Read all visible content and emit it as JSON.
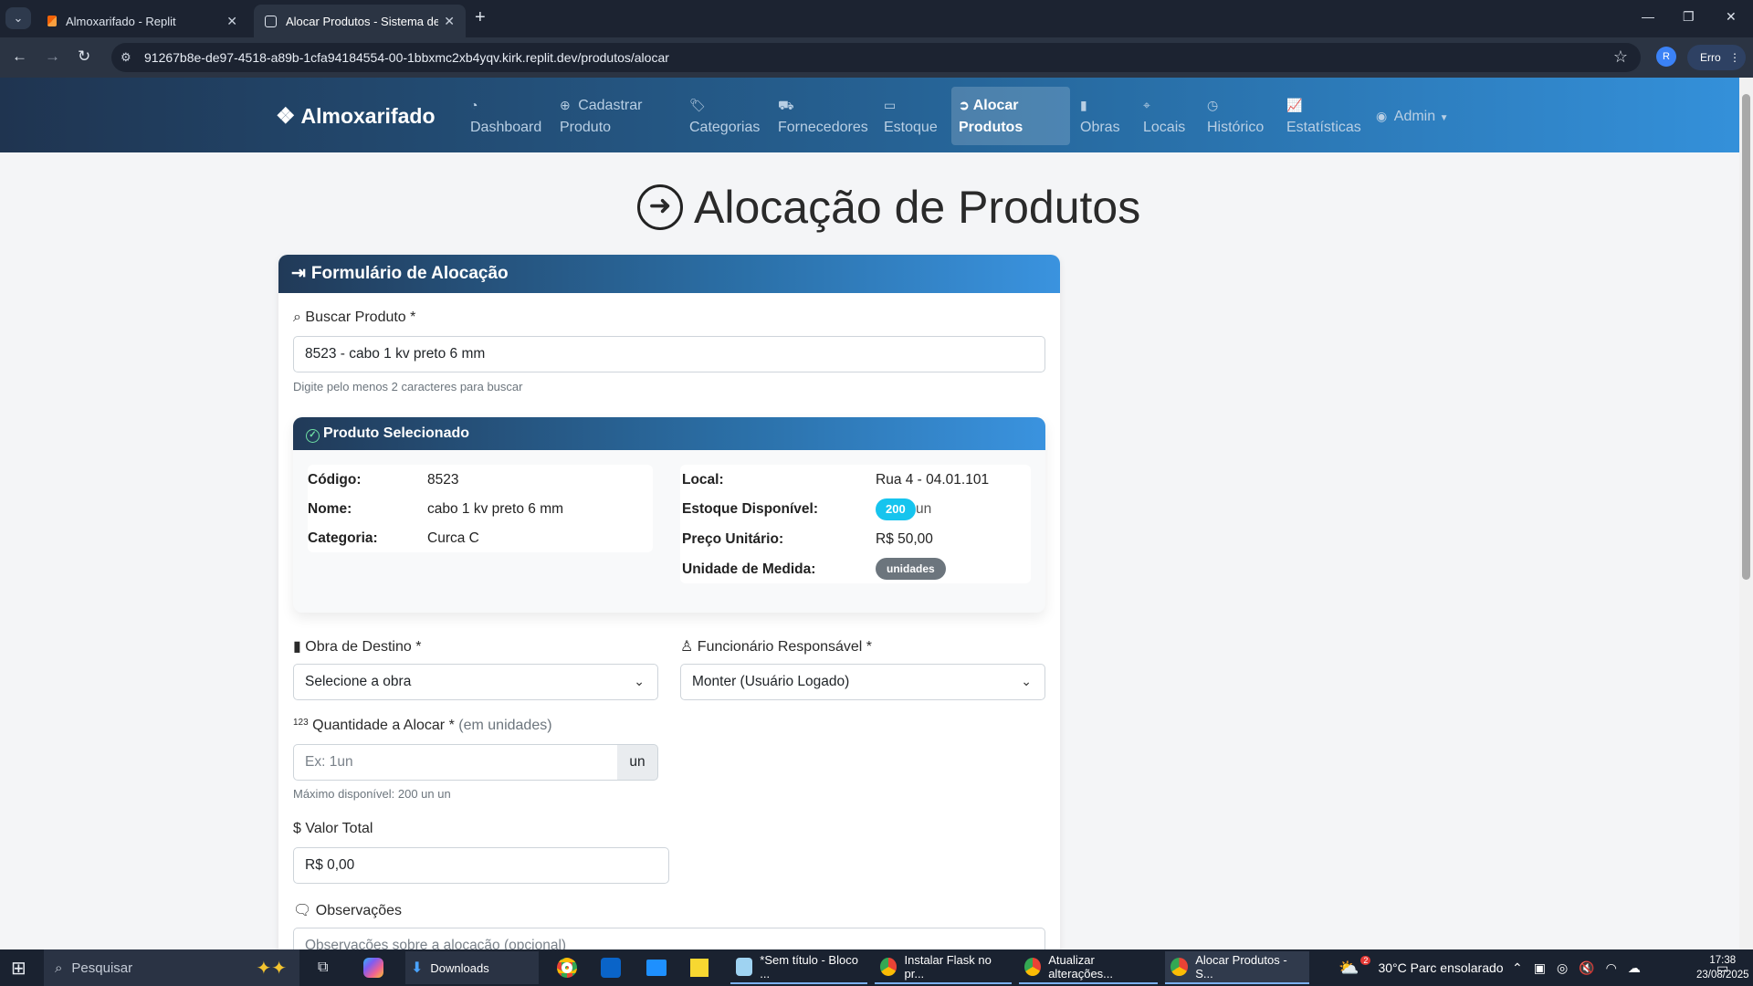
{
  "browser": {
    "tabs": [
      {
        "title": "Almoxarifado - Replit",
        "active": false
      },
      {
        "title": "Alocar Produtos - Sistema de Al",
        "active": true
      }
    ],
    "url": "91267b8e-de97-4518-a89b-1cfa94184554-00-1bbxmc2xb4yqv.kirk.replit.dev/produtos/alocar",
    "profile_initial": "R",
    "error_label": "Erro"
  },
  "nav": {
    "brand": "Almoxarifado",
    "items": [
      {
        "icon": "dashboard-icon",
        "label": "Dashboard"
      },
      {
        "icon": "plus-circle-icon",
        "label": "Cadastrar\nProduto"
      },
      {
        "icon": "tags-icon",
        "label": "Categorias"
      },
      {
        "icon": "truck-icon",
        "label": "Fornecedores"
      },
      {
        "icon": "box-icon",
        "label": "Estoque"
      },
      {
        "icon": "arrow-circle-icon",
        "label": "Alocar\nProdutos"
      },
      {
        "icon": "building-icon",
        "label": "Obras"
      },
      {
        "icon": "map-pin-icon",
        "label": "Locais"
      },
      {
        "icon": "history-icon",
        "label": "Histórico"
      },
      {
        "icon": "chart-icon",
        "label": "Estatísticas"
      },
      {
        "icon": "user-circle-icon",
        "label": "Admin"
      }
    ]
  },
  "page": {
    "title": "Alocação de Produtos"
  },
  "form": {
    "header": "Formulário de Alocação",
    "search_label": "Buscar Produto *",
    "search_value": "8523 - cabo 1 kv preto 6 mm",
    "search_help": "Digite pelo menos 2 caracteres para buscar",
    "selected": {
      "header": "Produto Selecionado",
      "codigo_label": "Código:",
      "codigo": "8523",
      "nome_label": "Nome:",
      "nome": "cabo 1 kv preto 6 mm",
      "categoria_label": "Categoria:",
      "categoria": "Curca C",
      "local_label": "Local:",
      "local": "Rua 4 - 04.01.101",
      "estoque_label": "Estoque Disponível:",
      "estoque": "200",
      "estoque_unit": "un",
      "preco_label": "Preço Unitário:",
      "preco": "R$ 50,00",
      "unidade_label": "Unidade de Medida:",
      "unidade": "unidades"
    },
    "obra_label": "Obra de Destino *",
    "obra_value": "Selecione a obra",
    "funcionario_label": "Funcionário Responsável *",
    "funcionario_value": "Monter (Usuário Logado)",
    "quantidade_prefix": "123",
    "quantidade_label": "Quantidade a Alocar *",
    "quantidade_hint": "(em unidades)",
    "quantidade_placeholder": "Ex: 1un",
    "quantidade_addon": "un",
    "quantidade_help": "Máximo disponível: 200 un un",
    "valor_label": "Valor Total",
    "valor_value": "R$ 0,00",
    "observacoes_label": "Observações",
    "observacoes_placeholder": "Observações sobre a alocação (opcional)"
  },
  "taskbar": {
    "search": "Pesquisar",
    "apps": [
      {
        "label": "Downloads"
      },
      {
        "label": "*Sem título - Bloco ..."
      },
      {
        "label": "Instalar Flask no pr..."
      },
      {
        "label": "Atualizar alterações..."
      },
      {
        "label": "Alocar Produtos - S..."
      }
    ],
    "weather": "30°C  Parc ensolarado",
    "weather_badge": "2",
    "time": "17:38",
    "date": "23/08/2025"
  }
}
